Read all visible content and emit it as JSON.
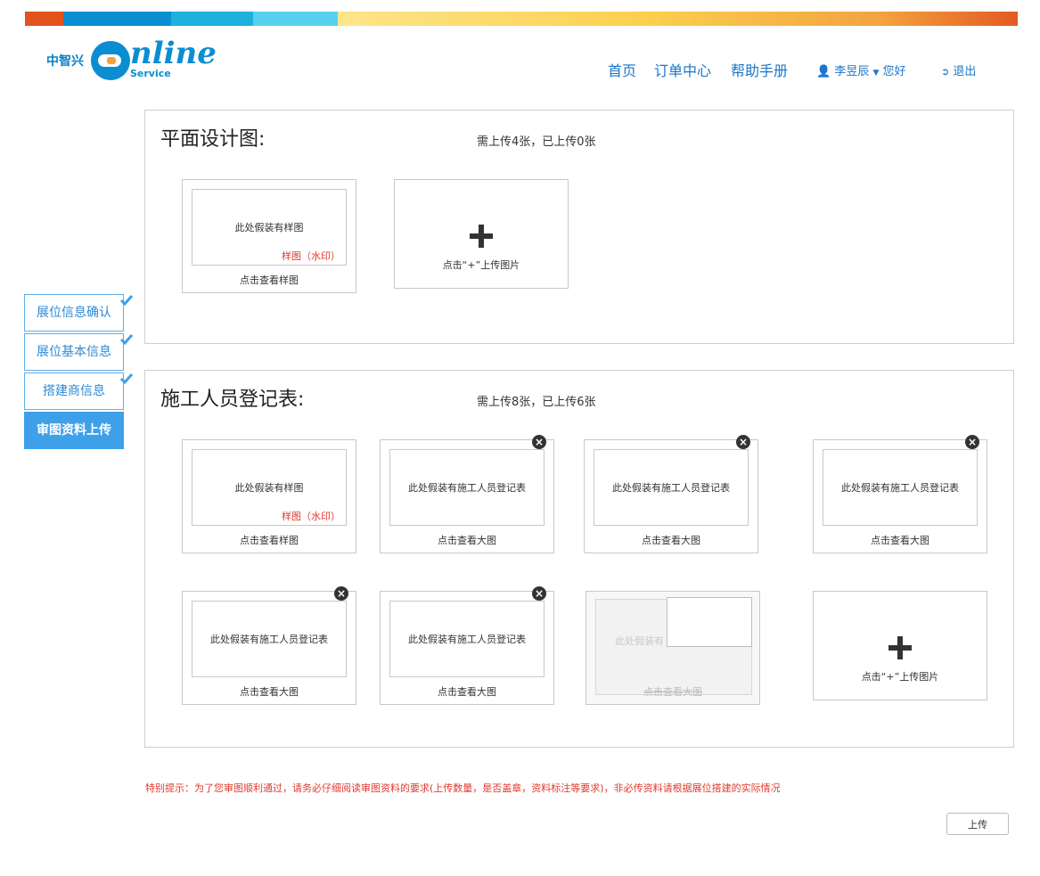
{
  "logo": {
    "cn": "中智兴",
    "word": "nline",
    "service": "Service"
  },
  "nav": {
    "items": [
      "首页",
      "订单中心",
      "帮助手册"
    ],
    "user": "李昱辰",
    "greeting": "您好",
    "logout": "退出"
  },
  "sidebar": {
    "steps": [
      {
        "label": "展位信息确认",
        "done": true
      },
      {
        "label": "展位基本信息",
        "done": true
      },
      {
        "label": "搭建商信息",
        "done": true
      },
      {
        "label": "审图资料上传",
        "active": true
      }
    ]
  },
  "sections": [
    {
      "title": "平面设计图:",
      "count": "需上传4张，已上传0张",
      "sample": {
        "text": "此处假装有样图",
        "watermark": "样图（水印）",
        "caption": "点击查看样图"
      },
      "upload_label": "点击“+”上传图片"
    },
    {
      "title": "施工人员登记表:",
      "count": "需上传8张，已上传6张",
      "sample": {
        "text": "此处假装有样图",
        "watermark": "样图（水印）",
        "caption": "点击查看样图"
      },
      "uploaded_text": "此处假装有施工人员登记表",
      "uploaded_caption": "点击查看大图",
      "dragging_text": "此处假装有",
      "upload_label": "点击“+”上传图片"
    }
  ],
  "notice": "特别提示：为了您审图顺利通过，请务必仔细阅读审图资料的要求(上传数量，是否盖章，资料标注等要求)，非必传资料请根据展位搭建的实际情况",
  "submit_label": "上传",
  "colors": {
    "accent": "#3fa0ea",
    "link": "#1a76c8",
    "warning": "#e03a2e"
  }
}
